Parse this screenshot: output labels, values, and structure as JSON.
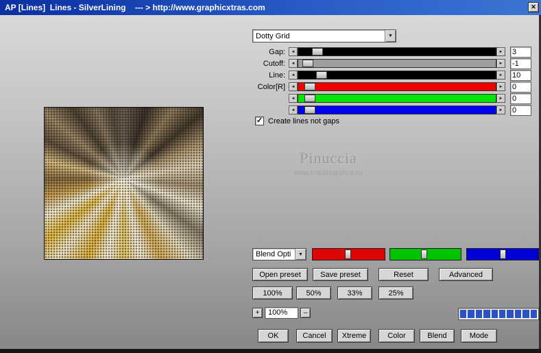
{
  "icons": {
    "close": "✕",
    "dropdown_arrow": "▼",
    "check": "✓",
    "arrow_left": "◄",
    "arrow_right": "►"
  },
  "window": {
    "title": "AP [Lines]  Lines - SilverLining    --- > http://www.graphicxtras.com"
  },
  "colors": {
    "titlebar_start": "#0c2fa2",
    "titlebar_end": "#3a75d4",
    "progress_fill": "#2d52c4"
  },
  "preset_dropdown": {
    "value": "Dotty Grid"
  },
  "sliders": [
    {
      "label": "Gap:",
      "value": "3",
      "track_color": "#000000",
      "thumb_percent": 7
    },
    {
      "label": "Cutoff:",
      "value": "-1",
      "track_color": "#9e9e9e",
      "thumb_percent": 2
    },
    {
      "label": "Line:",
      "value": "10",
      "track_color": "#000000",
      "thumb_percent": 9
    },
    {
      "label": "Color[R]",
      "value": "0",
      "track_color": "#f20000",
      "thumb_percent": 3
    },
    {
      "label": "",
      "value": "0",
      "track_color": "#00e400",
      "thumb_percent": 3
    },
    {
      "label": "",
      "value": "0",
      "track_color": "#0000f0",
      "thumb_percent": 3
    }
  ],
  "checkbox": {
    "label": "Create lines not gaps",
    "checked": true
  },
  "watermark": {
    "name": "Pinuccia",
    "url": "www.maidiregrafica.eu"
  },
  "blend_dropdown": {
    "value": "Blend Opti"
  },
  "rgb_bars": [
    {
      "name": "red",
      "color": "#dd0505",
      "thumb_percent": 45
    },
    {
      "name": "green",
      "color": "#00c400",
      "thumb_percent": 44
    },
    {
      "name": "blue",
      "color": "#0000d8",
      "thumb_percent": 46
    }
  ],
  "preset_buttons": [
    "Open preset",
    "Save preset",
    "Reset",
    "Advanced"
  ],
  "zoom_buttons": [
    "100%",
    "50%",
    "33%",
    "25%"
  ],
  "zoom_stepper": {
    "plus": "+",
    "value": "100%",
    "minus": "–"
  },
  "progress": {
    "segments": 10,
    "filled": 10
  },
  "action_buttons": [
    "OK",
    "Cancel",
    "Xtreme",
    "Color",
    "Blend",
    "Mode"
  ]
}
